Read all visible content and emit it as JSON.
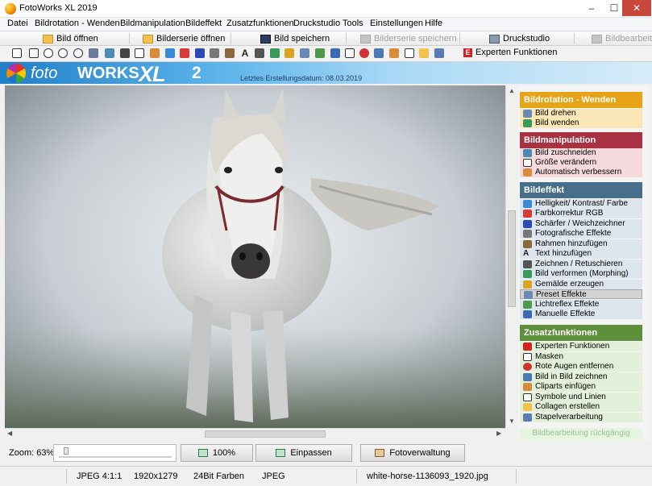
{
  "window": {
    "title": "FotoWorks XL 2019",
    "min_glyph": "–",
    "max_glyph": "☐",
    "close_glyph": "✕"
  },
  "menu": {
    "items": [
      "Datei",
      "Bildrotation - Wenden",
      "Bildmanipulation",
      "Bildeffekt",
      "Zusatzfunktionen",
      "Druckstudio",
      "Tools",
      "Einstellungen",
      "Hilfe"
    ]
  },
  "toolbar": {
    "open_image": "Bild öffnen",
    "open_series": "Bilderserie öffnen",
    "save_image": "Bild speichern",
    "save_series": "Bilderserie speichern",
    "print_studio": "Druckstudio",
    "edit_image": "Bildbearbeitung"
  },
  "toolbar2": {
    "expert": "Experten Funktionen",
    "text_tool_glyph": "A"
  },
  "banner": {
    "logo_foto": "foto",
    "logo_works": "WORKS",
    "logo_xl": "XL",
    "logo_version": "2",
    "date_text": "Letztes Erstellungsdatum: 08.03.2019"
  },
  "panel": {
    "sections": [
      {
        "title": "Bildrotation - Wenden",
        "color": "#e8a317",
        "items": [
          "Bild drehen",
          "Bild wenden"
        ]
      },
      {
        "title": "Bildmanipulation",
        "color": "#a83242",
        "items": [
          "Bild zuschneiden",
          "Größe verändern",
          "Automatisch verbessern"
        ]
      },
      {
        "title": "Bildeffekt",
        "color": "#486f8a",
        "items": [
          "Helligkeit/ Kontrast/ Farbe",
          "Farbkorrektur RGB",
          "Schärfer / Weichzeichner",
          "Fotografische Effekte",
          "Rahmen hinzufügen",
          "Text hinzufügen",
          "Zeichnen / Retuschieren",
          "Bild verformen (Morphing)",
          "Gemälde erzeugen",
          "Preset Effekte",
          "Lichtreflex Effekte",
          "Manuelle Effekte"
        ]
      },
      {
        "title": "Zusatzfunktionen",
        "color": "#5e8f3a",
        "items": [
          "Experten Funktionen",
          "Masken",
          "Rote Augen entfernen",
          "Bild in Bild zeichnen",
          "Cliparts einfügen",
          "Symbole und Linien",
          "Collagen erstellen",
          "Stapelverarbeitung"
        ]
      }
    ],
    "undo": "Bildbearbeitung rückgängig"
  },
  "bottom": {
    "zoom_label": "Zoom: 63%",
    "btn_100": "100%",
    "btn_fit": "Einpassen",
    "btn_manage": "Fotoverwaltung"
  },
  "status": {
    "format": "JPEG  4:1:1",
    "dims": "1920x1279",
    "colors": "24Bit Farben",
    "type": "JPEG",
    "filename": "white-horse-1136093_1920.jpg"
  },
  "scroll": {
    "up": "▲",
    "down": "▼",
    "left": "◀",
    "right": "▶"
  },
  "icons": {
    "section_item_colors": [
      "#6a8ab5",
      "#c86a3a",
      "#4a8a4a",
      "#b55a9a",
      "#d9a520",
      "#3a6ab5"
    ]
  }
}
